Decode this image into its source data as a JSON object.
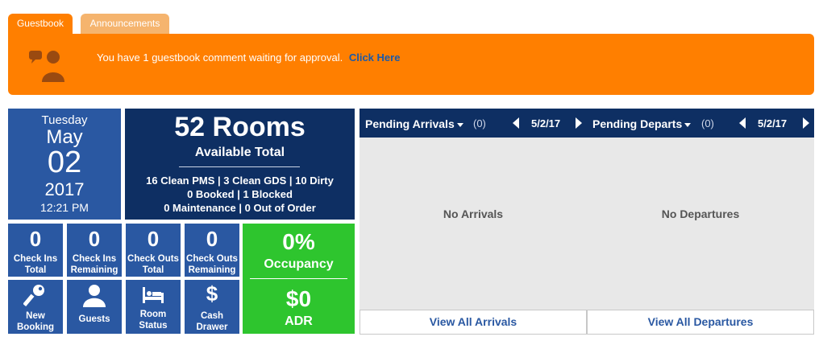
{
  "tabs": [
    {
      "label": "Guestbook",
      "active": true
    },
    {
      "label": "Announcements",
      "active": false
    }
  ],
  "banner": {
    "message": "You have 1 guestbook comment waiting for approval.",
    "link": "Click Here",
    "icon": "chat-users-icon"
  },
  "date": {
    "weekday": "Tuesday",
    "month": "May",
    "day": "02",
    "year": "2017",
    "time": "12:21 PM"
  },
  "rooms": {
    "count": "52 Rooms",
    "subtitle": "Available Total",
    "stats": [
      "16 Clean PMS | 3 Clean GDS | 10 Dirty",
      "0 Booked | 1 Blocked",
      "0 Maintenance | 0 Out of Order"
    ]
  },
  "counters": [
    {
      "value": "0",
      "label1": "Check Ins",
      "label2": "Total"
    },
    {
      "value": "0",
      "label1": "Check Ins",
      "label2": "Remaining"
    },
    {
      "value": "0",
      "label1": "Check Outs",
      "label2": "Total"
    },
    {
      "value": "0",
      "label1": "Check Outs",
      "label2": "Remaining"
    }
  ],
  "actions": [
    {
      "label1": "New",
      "label2": "Booking",
      "icon": "key-icon"
    },
    {
      "label1": "Guests",
      "label2": "",
      "icon": "user-icon"
    },
    {
      "label1": "Room",
      "label2": "Status",
      "icon": "bed-icon"
    },
    {
      "label1": "Cash",
      "label2": "Drawer",
      "icon": "dollar-icon"
    }
  ],
  "occupancy": {
    "percent": "0%",
    "label": "Occupancy",
    "adr": "$0",
    "adr_label": "ADR"
  },
  "arrivals": {
    "title": "Pending Arrivals",
    "count": "(0)",
    "date": "5/2/17",
    "empty": "No Arrivals",
    "footer": "View All Arrivals"
  },
  "departures": {
    "title": "Pending Departs",
    "count": "(0)",
    "date": "5/2/17",
    "empty": "No Departures",
    "footer": "View All Departures"
  },
  "colors": {
    "orange": "#ff7f00",
    "light_orange": "#f5b46e",
    "blue": "#2a58a2",
    "navy": "#0e2f63",
    "green": "#2ec52e"
  }
}
